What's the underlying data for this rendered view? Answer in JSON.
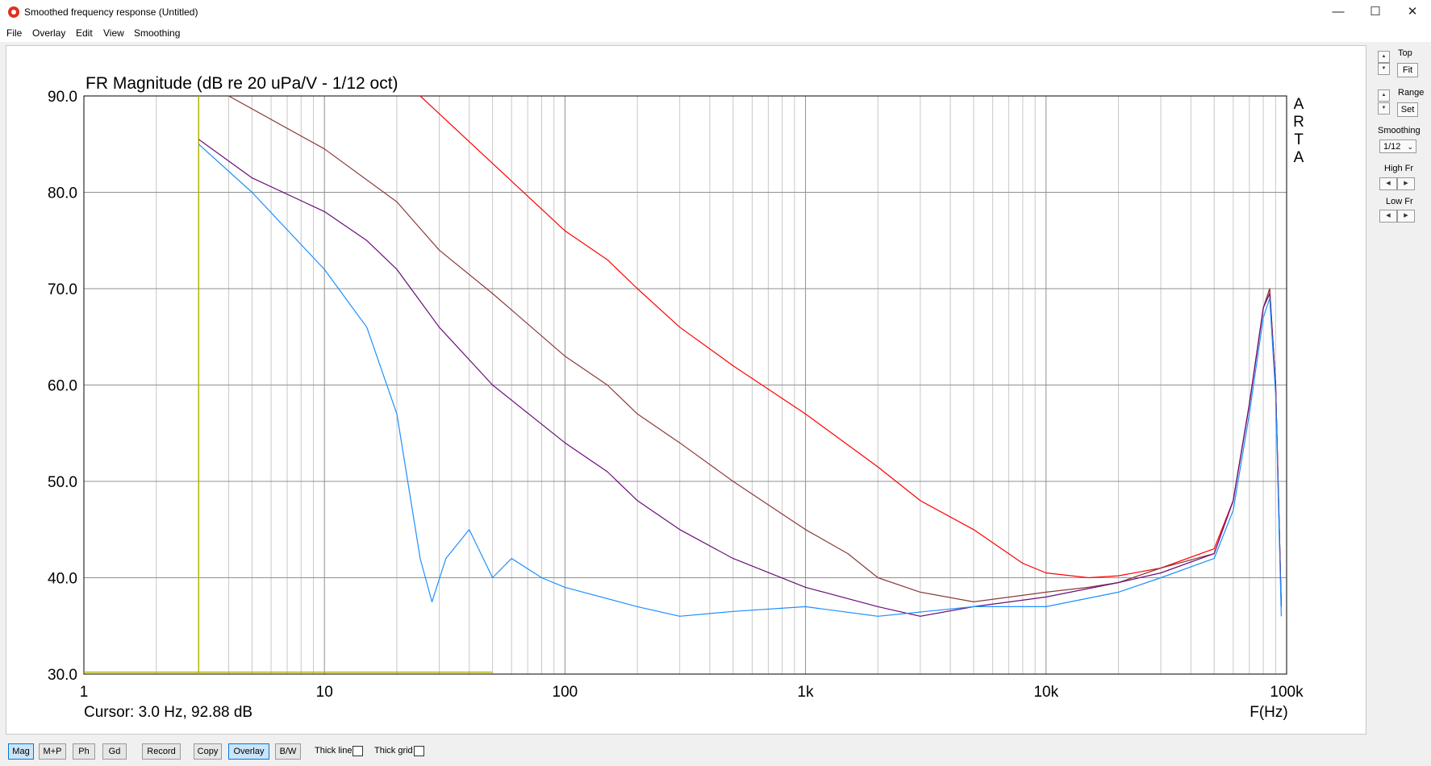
{
  "window": {
    "title": "Smoothed frequency response (Untitled)",
    "minimize": "—",
    "maximize": "☐",
    "close": "✕"
  },
  "menu": [
    "File",
    "Overlay",
    "Edit",
    "View",
    "Smoothing"
  ],
  "side_panel": {
    "top_label": "Top",
    "fit_label": "Fit",
    "range_label": "Range",
    "set_label": "Set",
    "smoothing_label": "Smoothing",
    "smoothing_value": "1/12",
    "high_fr_label": "High Fr",
    "low_fr_label": "Low Fr"
  },
  "bottom_bar": {
    "buttons": [
      "Mag",
      "M+P",
      "Ph",
      "Gd",
      "Record",
      "Copy",
      "Overlay",
      "B/W"
    ],
    "thick_line_label": "Thick line",
    "thick_grid_label": "Thick grid"
  },
  "chart_data": {
    "type": "line",
    "title": "FR Magnitude (dB re 20 uPa/V - 1/12 oct)",
    "xlabel": "F(Hz)",
    "ylabel": "",
    "watermark": "ARTA",
    "cursor_readout": "Cursor: 3.0 Hz, 92.88 dB",
    "x_scale": "log",
    "xlim": [
      1,
      100000
    ],
    "ylim": [
      30,
      90
    ],
    "x_tick_labels": [
      "1",
      "10",
      "100",
      "1k",
      "10k",
      "100k"
    ],
    "y_tick_labels": [
      "90.0",
      "80.0",
      "70.0",
      "60.0",
      "50.0",
      "40.0",
      "30.0"
    ],
    "grid": true,
    "cursor": {
      "x": 3.0,
      "y": 92.88
    },
    "marker_line": {
      "x": [
        1,
        50
      ],
      "y": 30.2
    },
    "colors": {
      "red": "#ff0000",
      "brown": "#8b3a3a",
      "purple": "#6a0d7a",
      "blue": "#1e8fff",
      "cursor": "#b4b400",
      "grid": "#c8c8c8"
    },
    "series": [
      {
        "color": "#ff0000",
        "x": [
          25,
          50,
          100,
          150,
          200,
          300,
          500,
          1000,
          2000,
          3000,
          5000,
          8000,
          10000,
          15000,
          20000,
          30000,
          50000,
          60000,
          70000,
          80000,
          85000,
          90000,
          95000
        ],
        "y": [
          91,
          83,
          76,
          73,
          70,
          66,
          62,
          57,
          51.5,
          48,
          45,
          41.5,
          40.5,
          40,
          40.2,
          41,
          43,
          48,
          58,
          68,
          70,
          60,
          37
        ]
      },
      {
        "color": "#8b3a3a",
        "x": [
          4,
          10,
          20,
          30,
          50,
          100,
          150,
          200,
          300,
          500,
          1000,
          1500,
          2000,
          3000,
          5000,
          10000,
          15000,
          20000,
          30000,
          50000,
          60000,
          70000,
          80000,
          85000,
          90000,
          95000
        ],
        "y": [
          90,
          84.5,
          79,
          74,
          69.5,
          63,
          60,
          57,
          54,
          50,
          45,
          42.5,
          40,
          38.5,
          37.5,
          38.5,
          39,
          39.5,
          41,
          42.5,
          48,
          58,
          68,
          70,
          60,
          37
        ]
      },
      {
        "color": "#6a0d7a",
        "x": [
          3,
          5,
          10,
          15,
          20,
          30,
          50,
          100,
          150,
          200,
          300,
          500,
          1000,
          2000,
          3000,
          5000,
          10000,
          20000,
          30000,
          50000,
          60000,
          70000,
          80000,
          85000,
          90000,
          95000
        ],
        "y": [
          85.5,
          81.5,
          78,
          75,
          72,
          66,
          60,
          54,
          51,
          48,
          45,
          42,
          39,
          37,
          36,
          37,
          38,
          39.5,
          40.5,
          42.5,
          48,
          58,
          68,
          69.5,
          60,
          37
        ]
      },
      {
        "color": "#1e8fff",
        "x": [
          3,
          5,
          10,
          15,
          20,
          25,
          28,
          32,
          40,
          50,
          60,
          80,
          100,
          200,
          300,
          500,
          1000,
          2000,
          5000,
          10000,
          20000,
          30000,
          50000,
          60000,
          70000,
          80000,
          85000,
          90000,
          95000
        ],
        "y": [
          85,
          80,
          72,
          66,
          57,
          42,
          37.5,
          42,
          45,
          40,
          42,
          40,
          39,
          37,
          36,
          36.5,
          37,
          36,
          37,
          37,
          38.5,
          40,
          42,
          47,
          57,
          67,
          69,
          59,
          36
        ]
      }
    ]
  }
}
